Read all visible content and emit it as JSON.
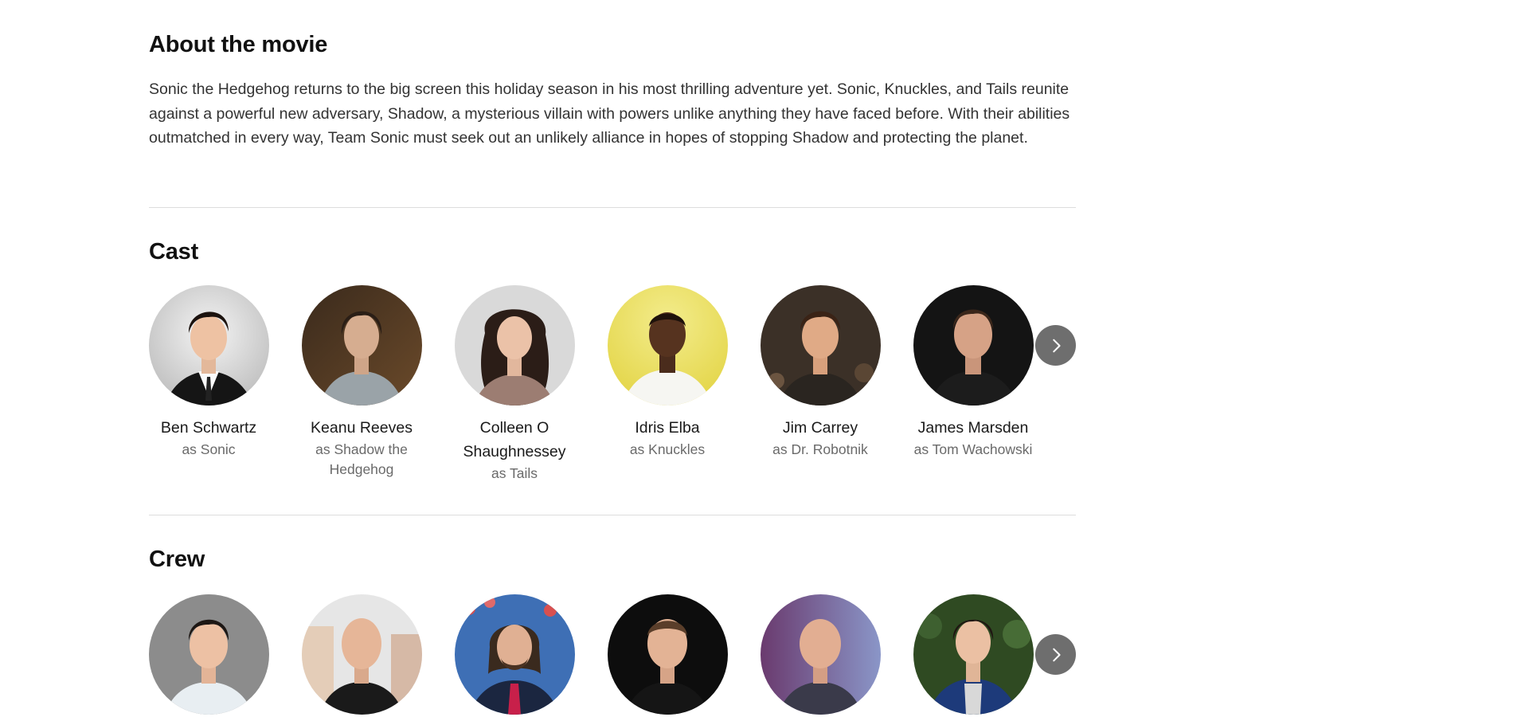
{
  "about": {
    "title": "About the movie",
    "text": "Sonic the Hedgehog returns to the big screen this holiday season in his most thrilling adventure yet. Sonic, Knuckles, and Tails reunite against a powerful new adversary, Shadow, a mysterious villain with powers unlike anything they have faced before. With their abilities outmatched in every way, Team Sonic must seek out an unlikely alliance in hopes of stopping Shadow and protecting the planet."
  },
  "cast": {
    "title": "Cast",
    "next_icon": "chevron-right-icon",
    "members": [
      {
        "name": "Ben Schwartz",
        "role": "as Sonic"
      },
      {
        "name": "Keanu Reeves",
        "role": "as Shadow the Hedgehog"
      },
      {
        "name": "Colleen O Shaughnessey",
        "role": "as Tails"
      },
      {
        "name": "Idris Elba",
        "role": "as Knuckles"
      },
      {
        "name": "Jim Carrey",
        "role": "as Dr. Robotnik"
      },
      {
        "name": "James Marsden",
        "role": "as Tom Wachowski"
      }
    ]
  },
  "crew": {
    "title": "Crew",
    "next_icon": "chevron-right-icon"
  },
  "colors": {
    "next_button": "#6e6e6e",
    "divider": "#dddddd",
    "role_text": "#6a6a6a"
  }
}
